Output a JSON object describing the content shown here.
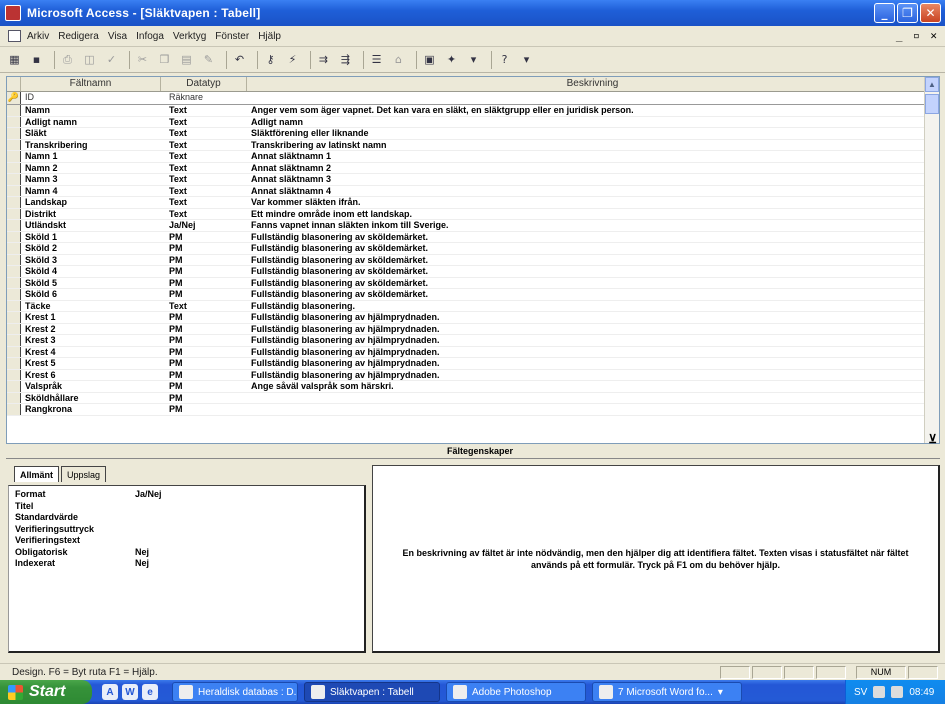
{
  "window": {
    "title": "Microsoft Access - [Släktvapen : Tabell]"
  },
  "menu": {
    "items": [
      "Arkiv",
      "Redigera",
      "Visa",
      "Infoga",
      "Verktyg",
      "Fönster",
      "Hjälp"
    ],
    "mdi_controls": "_ ▫ ✕"
  },
  "toolbar_icons": [
    "design-view-icon",
    "save-icon",
    "print-icon",
    "print-preview-icon",
    "spelling-icon",
    "cut-icon",
    "copy-icon",
    "paste-icon",
    "format-painter-icon",
    "undo-icon",
    "primary-key-icon",
    "indexes-icon",
    "insert-rows-icon",
    "delete-rows-icon",
    "properties-icon",
    "build-icon",
    "database-window-icon",
    "new-object-icon",
    "help-icon"
  ],
  "grid": {
    "headers": {
      "field": "Fältnamn",
      "type": "Datatyp",
      "desc": "Beskrivning"
    },
    "rows": [
      {
        "marker": "🔑",
        "field": "ID",
        "type": "Räknare",
        "desc": ""
      },
      {
        "field": "Namn",
        "type": "Text",
        "desc": "Anger vem som äger vapnet. Det kan vara en släkt, en släktgrupp eller en juridisk person."
      },
      {
        "field": "Adligt namn",
        "type": "Text",
        "desc": "Adligt namn"
      },
      {
        "field": "Släkt",
        "type": "Text",
        "desc": "Släktförening eller liknande"
      },
      {
        "field": "Transkribering",
        "type": "Text",
        "desc": "Transkribering av latinskt namn"
      },
      {
        "field": "Namn 1",
        "type": "Text",
        "desc": "Annat släktnamn 1"
      },
      {
        "field": "Namn 2",
        "type": "Text",
        "desc": "Annat släktnamn 2"
      },
      {
        "field": "Namn 3",
        "type": "Text",
        "desc": "Annat släktnamn 3"
      },
      {
        "field": "Namn 4",
        "type": "Text",
        "desc": "Annat släktnamn 4"
      },
      {
        "field": "Landskap",
        "type": "Text",
        "desc": "Var kommer släkten ifrån."
      },
      {
        "field": "Distrikt",
        "type": "Text",
        "desc": "Ett mindre område inom ett landskap."
      },
      {
        "field": "Utländskt",
        "type": "Ja/Nej",
        "desc": "Fanns vapnet innan släkten inkom till Sverige."
      },
      {
        "field": "Sköld 1",
        "type": "PM",
        "desc": "Fullständig blasonering av sköldemärket."
      },
      {
        "field": "Sköld 2",
        "type": "PM",
        "desc": "Fullständig blasonering av sköldemärket."
      },
      {
        "field": "Sköld 3",
        "type": "PM",
        "desc": "Fullständig blasonering av sköldemärket."
      },
      {
        "field": "Sköld 4",
        "type": "PM",
        "desc": "Fullständig blasonering av sköldemärket."
      },
      {
        "field": "Sköld 5",
        "type": "PM",
        "desc": "Fullständig blasonering av sköldemärket."
      },
      {
        "field": "Sköld 6",
        "type": "PM",
        "desc": "Fullständig blasonering av sköldemärket."
      },
      {
        "field": "Täcke",
        "type": "Text",
        "desc": "Fullständig blasonering."
      },
      {
        "field": "Krest 1",
        "type": "PM",
        "desc": "Fullständig blasonering av hjälmprydnaden."
      },
      {
        "field": "Krest 2",
        "type": "PM",
        "desc": "Fullständig blasonering av hjälmprydnaden."
      },
      {
        "field": "Krest 3",
        "type": "PM",
        "desc": "Fullständig blasonering av hjälmprydnaden."
      },
      {
        "field": "Krest 4",
        "type": "PM",
        "desc": "Fullständig blasonering av hjälmprydnaden."
      },
      {
        "field": "Krest 5",
        "type": "PM",
        "desc": "Fullständig blasonering av hjälmprydnaden."
      },
      {
        "field": "Krest 6",
        "type": "PM",
        "desc": "Fullständig blasonering av hjälmprydnaden."
      },
      {
        "field": "Valspråk",
        "type": "PM",
        "desc": "Ange såväl valspråk som härskri."
      },
      {
        "field": "Sköldhållare",
        "type": "PM",
        "desc": ""
      },
      {
        "field": "Rangkrona",
        "type": "PM",
        "desc": ""
      }
    ]
  },
  "properties": {
    "section_label": "Fältegenskaper",
    "tabs": [
      "Allmänt",
      "Uppslag"
    ],
    "rows": [
      {
        "label": "Format",
        "value": "Ja/Nej"
      },
      {
        "label": "Titel",
        "value": ""
      },
      {
        "label": "Standardvärde",
        "value": ""
      },
      {
        "label": "Verifieringsuttryck",
        "value": ""
      },
      {
        "label": "Verifieringstext",
        "value": ""
      },
      {
        "label": "Obligatorisk",
        "value": "Nej"
      },
      {
        "label": "Indexerat",
        "value": "Nej"
      }
    ],
    "help_text": "En beskrivning av fältet är inte nödvändig, men den hjälper dig att identifiera fältet. Texten visas i statusfältet när fältet används på ett formulär. Tryck på F1 om du behöver hjälp."
  },
  "status": {
    "text": "Design. F6 = Byt ruta F1 = Hjälp.",
    "num": "NUM"
  },
  "taskbar": {
    "start": "Start",
    "tasks": [
      {
        "label": "Heraldisk databas : D...",
        "active": false
      },
      {
        "label": "Släktvapen : Tabell",
        "active": true
      },
      {
        "label": "Adobe Photoshop",
        "active": false
      },
      {
        "label": "7 Microsoft Word fo...",
        "active": false
      }
    ],
    "lang": "SV",
    "clock": "08:49"
  }
}
